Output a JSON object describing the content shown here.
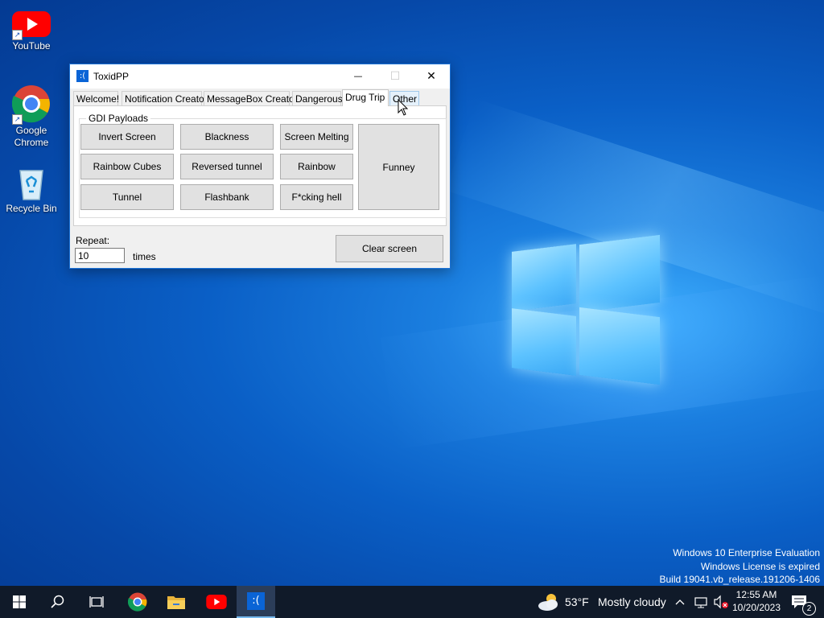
{
  "desktop": {
    "icons": [
      {
        "label": "YouTube",
        "icon": "youtube-icon"
      },
      {
        "label": "Google Chrome",
        "icon": "chrome-icon"
      },
      {
        "label": "Recycle Bin",
        "icon": "recycle-bin-icon"
      }
    ],
    "watermark": {
      "line1": "Windows 10 Enterprise Evaluation",
      "line2": "Windows License is expired",
      "line3": "Build 19041.vb_release.191206-1406"
    }
  },
  "window": {
    "title": "ToxidPP",
    "app_icon_glyph": ":(",
    "controls": {
      "minimize": "—",
      "maximize": "☐",
      "close": "✕"
    },
    "tabs": [
      {
        "label": "Welcome!"
      },
      {
        "label": "Notification Creator"
      },
      {
        "label": "MessageBox Creator"
      },
      {
        "label": "Dangerous"
      },
      {
        "label": "Drug Trip",
        "active": true
      },
      {
        "label": "Other",
        "hovered": true
      }
    ],
    "group_label": "GDI Payloads",
    "buttons": {
      "invert_screen": "Invert Screen",
      "blackness": "Blackness",
      "screen_melting": "Screen Melting",
      "funney": "Funney",
      "rainbow_cubes": "Rainbow Cubes",
      "reversed_tunnel": "Reversed tunnel",
      "rainbow": "Rainbow",
      "tunnel": "Tunnel",
      "flashbank": "Flashbank",
      "fcking_hell": "F*cking hell",
      "clear_screen": "Clear screen"
    },
    "repeat_label": "Repeat:",
    "repeat_value": "10",
    "times_label": "times"
  },
  "taskbar": {
    "items": [
      "start-icon",
      "search-icon",
      "task-view-icon",
      "chrome-icon",
      "file-explorer-icon",
      "youtube-icon",
      "toxidpp-icon"
    ],
    "active_item": "toxidpp-icon",
    "weather": {
      "temp": "53°F",
      "condition": "Mostly cloudy",
      "icon": "partly-cloudy-icon"
    },
    "time": "12:55 AM",
    "date": "10/20/2023",
    "notification_count": "2"
  },
  "colors": {
    "accent": "#0a64d6",
    "taskbar": "#101a29",
    "button_face": "#e1e1e1"
  }
}
